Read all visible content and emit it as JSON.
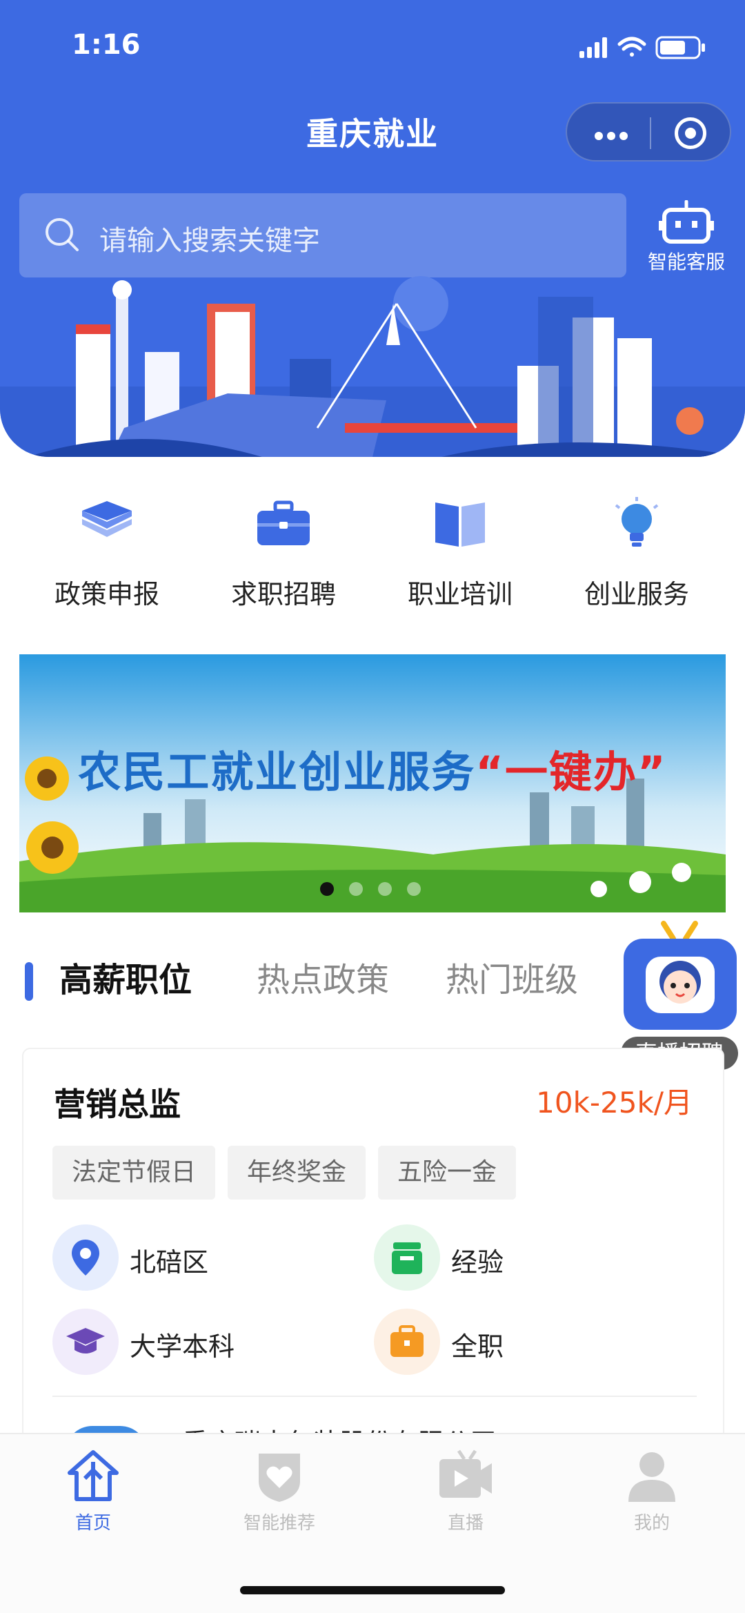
{
  "status": {
    "time": "1:16"
  },
  "header": {
    "title": "重庆就业",
    "customer_service": "智能客服"
  },
  "search": {
    "placeholder": "请输入搜索关键字"
  },
  "menu": [
    {
      "label": "政策申报",
      "icon": "layers-icon"
    },
    {
      "label": "求职招聘",
      "icon": "briefcase-icon"
    },
    {
      "label": "职业培训",
      "icon": "book-icon"
    },
    {
      "label": "创业服务",
      "icon": "lightbulb-icon"
    }
  ],
  "banner": {
    "headline_main": "农民工就业创业服务",
    "headline_quote": "“一键办”",
    "page_count": 4,
    "active_page": 1
  },
  "tabs": [
    {
      "label": "高薪职位",
      "active": true
    },
    {
      "label": "热点政策",
      "active": false
    },
    {
      "label": "热门班级",
      "active": false
    }
  ],
  "live": {
    "label": "直播招聘"
  },
  "job": {
    "title": "营销总监",
    "salary": "10k-25k/月",
    "tags": [
      "法定节假日",
      "年终奖金",
      "五险一金"
    ],
    "location": "北碚区",
    "experience": "经验",
    "education": "大学本科",
    "type": "全职",
    "company": "重庆瑞丰包装股份有限公司"
  },
  "nav": [
    {
      "label": "首页",
      "active": true,
      "icon": "home-icon"
    },
    {
      "label": "智能推荐",
      "active": false,
      "icon": "heart-shield-icon"
    },
    {
      "label": "直播",
      "active": false,
      "icon": "video-icon"
    },
    {
      "label": "我的",
      "active": false,
      "icon": "user-icon"
    }
  ],
  "colors": {
    "primary": "#3d6ae2",
    "salary": "#f0541e"
  }
}
